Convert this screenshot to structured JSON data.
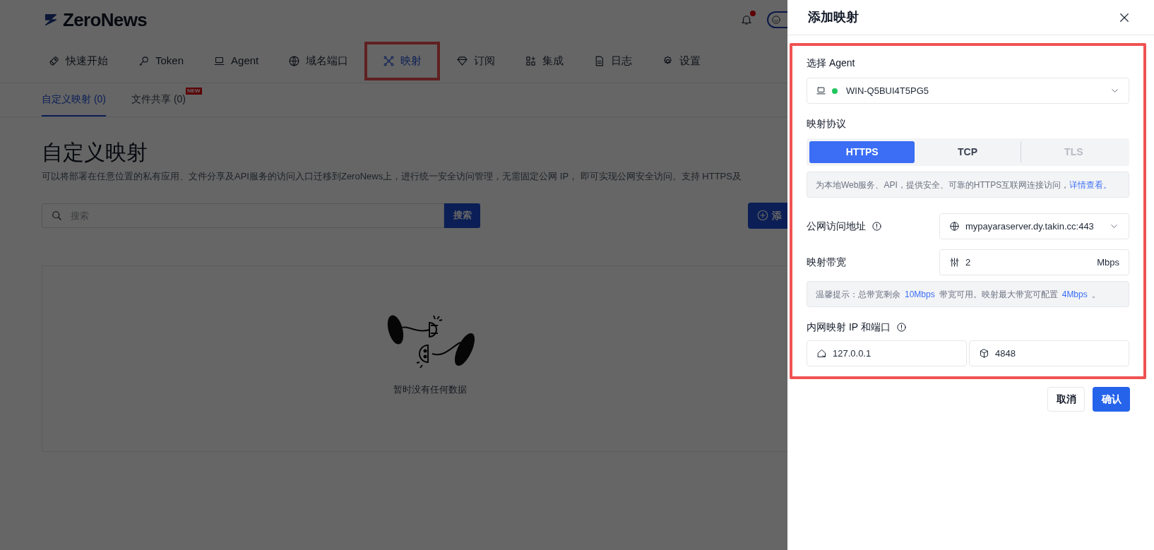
{
  "app": {
    "logo": "ZeroNews",
    "notification_dot": true
  },
  "nav": [
    {
      "label": "快速开始",
      "selected": false,
      "highlighted": false
    },
    {
      "label": "Token",
      "selected": false,
      "highlighted": false
    },
    {
      "label": "Agent",
      "selected": false,
      "highlighted": false
    },
    {
      "label": "域名端口",
      "selected": false,
      "highlighted": false
    },
    {
      "label": "映射",
      "selected": true,
      "highlighted": true
    },
    {
      "label": "订阅",
      "selected": false,
      "highlighted": false
    },
    {
      "label": "集成",
      "selected": false,
      "highlighted": false
    },
    {
      "label": "日志",
      "selected": false,
      "highlighted": false
    },
    {
      "label": "设置",
      "selected": false,
      "highlighted": false
    }
  ],
  "subtabs": [
    {
      "label": "自定义映射 (0)",
      "selected": true
    },
    {
      "label": "文件共享 (0)",
      "selected": false,
      "badge": "NEW"
    }
  ],
  "page": {
    "title": "自定义映射",
    "description": "可以将部署在任意位置的私有应用、文件分享及API服务的访问入口迁移到ZeroNews上，进行统一安全访问管理，无需固定公网 IP， 即可实现公网安全访问。支持 HTTPS及",
    "search": {
      "placeholder": "搜索",
      "button": "搜索"
    },
    "add_button": "添",
    "empty_text": "暂时没有任何数据"
  },
  "drawer": {
    "title": "添加映射",
    "highlighted": true,
    "agent": {
      "label": "选择 Agent",
      "value": "WIN-Q5BUI4T5PG5",
      "online": true
    },
    "protocol": {
      "label": "映射协议",
      "options": [
        {
          "label": "HTTPS",
          "selected": true,
          "disabled": false
        },
        {
          "label": "TCP",
          "selected": false,
          "disabled": false
        },
        {
          "label": "TLS",
          "selected": false,
          "disabled": true
        }
      ],
      "hint": "为本地Web服务、API，提供安全、可靠的HTTPS互联网连接访问，",
      "hint_link": "详情查看。"
    },
    "public_address": {
      "label": "公网访问地址",
      "value": "mypayaraserver.dy.takin.cc:443"
    },
    "bandwidth": {
      "label": "映射带宽",
      "value": "2",
      "unit": "Mbps",
      "note": [
        {
          "text": "温馨提示：总带宽剩余",
          "highlight": false
        },
        {
          "text": "10Mbps",
          "highlight": true
        },
        {
          "text": "带宽可用。映射最大带宽可配置",
          "highlight": false
        },
        {
          "text": "4Mbps",
          "highlight": true
        },
        {
          "text": "。",
          "highlight": false
        }
      ]
    },
    "internal": {
      "label": "内网映射 IP 和端口",
      "ip": "127.0.0.1",
      "port": "4848"
    },
    "buttons": {
      "cancel": "取消",
      "confirm": "确认"
    }
  }
}
